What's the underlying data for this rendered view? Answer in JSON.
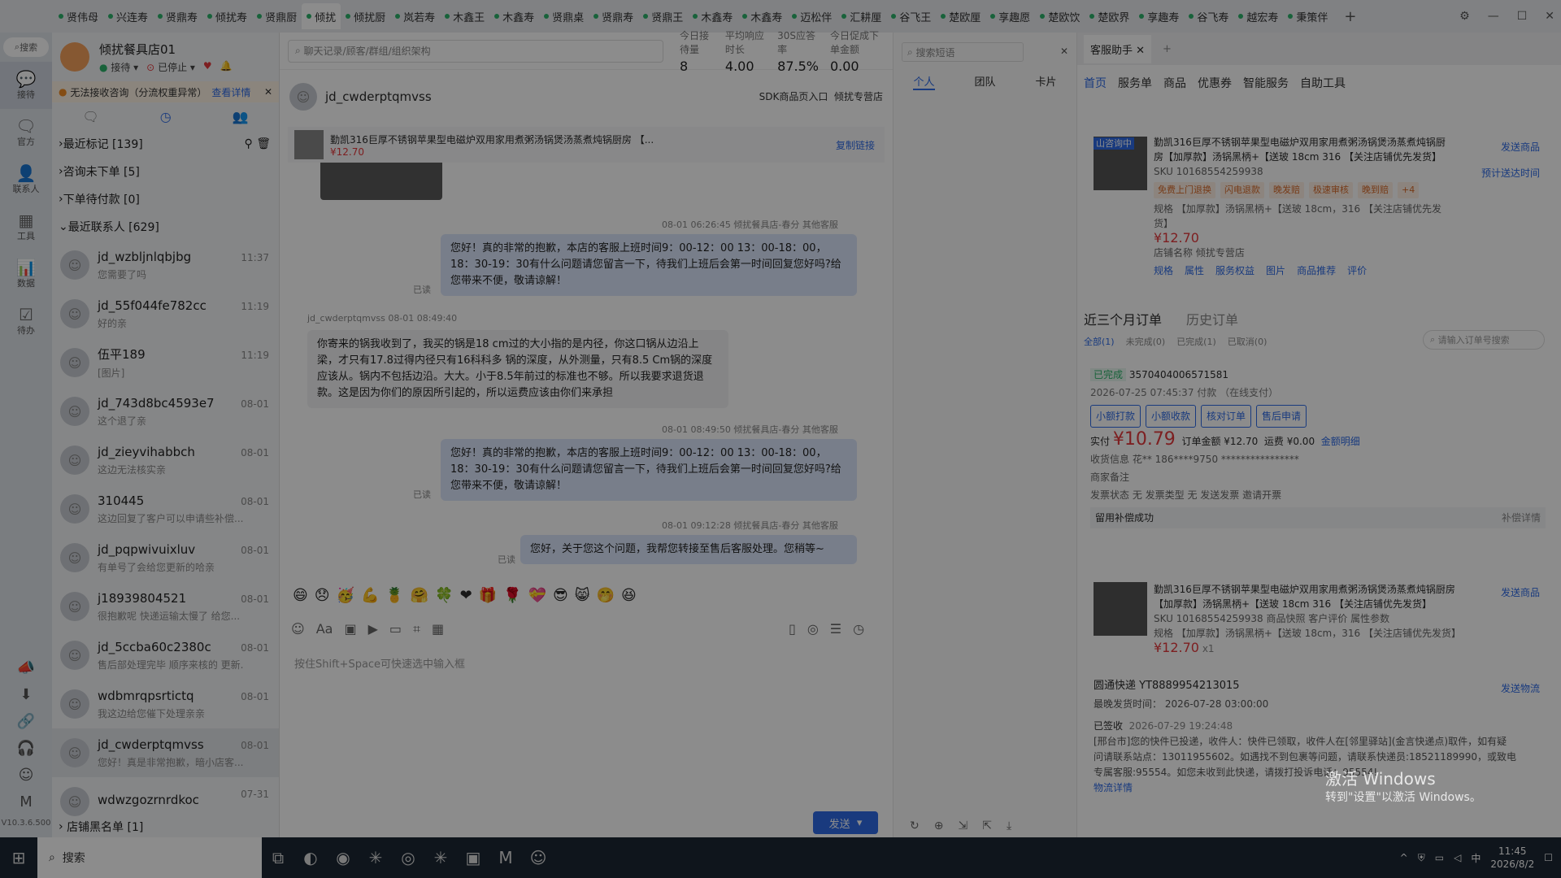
{
  "top_tabs": [
    "贤伟母",
    "兴连寿",
    "贤鼎寿",
    "倾扰寿",
    "贤鼎厨",
    "倾扰",
    "倾扰厨",
    "岚若寿",
    "木鑫王",
    "木鑫寿",
    "贤鼎桌",
    "贤鼎寿",
    "贤鼎王",
    "木鑫寿",
    "木鑫寿",
    "迈松伴",
    "汇耕厘",
    "谷飞王",
    "楚欧厘",
    "享趣愿",
    "楚欧饮",
    "楚欧界",
    "享趣寿",
    "谷飞寿",
    "越宏寿",
    "秉策伴"
  ],
  "rail": {
    "search": "搜索",
    "items": [
      {
        "icon": "💬",
        "label": "接待"
      },
      {
        "icon": "🗨",
        "label": "官方"
      },
      {
        "icon": "👤",
        "label": "联系人"
      },
      {
        "icon": "▦",
        "label": "工具"
      },
      {
        "icon": "📊",
        "label": "数据"
      },
      {
        "icon": "☑",
        "label": "待办"
      }
    ],
    "version": "V10.3.6.500",
    "bottom_icons": [
      "📣",
      "⬇",
      "🔗",
      "🎧",
      "☺",
      "M"
    ]
  },
  "shop": {
    "name": "倾扰餐具店01",
    "status": "接待",
    "stopped": "已停止"
  },
  "warning": {
    "text": "无法接收咨询（分流权重异常）",
    "link": "查看详情"
  },
  "groups": [
    "最近标记 [139]",
    "咨询未下单 [5]",
    "下单待付款 [0]",
    "最近联系人 [629]"
  ],
  "contacts": [
    {
      "name": "jd_wzbljnlqbjbg",
      "msg": "您需要了吗",
      "time": "11:37"
    },
    {
      "name": "jd_55f044fe782cc",
      "msg": "好的亲",
      "time": "11:19"
    },
    {
      "name": "伍平189",
      "msg": "[图片]",
      "time": "11:19"
    },
    {
      "name": "jd_743d8bc4593e7",
      "msg": "这个退了亲",
      "time": "08-01"
    },
    {
      "name": "jd_zieyvihabbch",
      "msg": "这边无法核实亲",
      "time": "08-01"
    },
    {
      "name": "310445",
      "msg": "这边回复了客户可以申请些补偿...",
      "time": "08-01"
    },
    {
      "name": "jd_pqpwivuixluv",
      "msg": "有单号了会给您更新的哈亲",
      "time": "08-01"
    },
    {
      "name": "j18939804521",
      "msg": "很抱歉呢 快递运输太慢了 给您...",
      "time": "08-01"
    },
    {
      "name": "jd_5ccba60c2380c",
      "msg": "售后部处理完毕 顺序来核的 更新...",
      "time": "08-01"
    },
    {
      "name": "wdbmrqpsrtictq",
      "msg": "我这边给您催下处理亲亲",
      "time": "08-01"
    },
    {
      "name": "jd_cwderptqmvss",
      "msg": "您好！真是非常抱歉，暗小店客...",
      "time": "08-01"
    },
    {
      "name": "wdwzgozrnrdkoc",
      "msg": "",
      "time": "07-31"
    }
  ],
  "blacklist": "店铺黑名单 [1]",
  "chat": {
    "search_placeholder": "聊天记录/顾客/群组/组织架构",
    "stats": [
      {
        "k": "今日接待量",
        "v": "8"
      },
      {
        "k": "平均响应时长",
        "v": "4.00"
      },
      {
        "k": "30S应答率",
        "v": "87.5%"
      },
      {
        "k": "今日促成下单金额",
        "v": "0.00"
      }
    ],
    "customer": "jd_cwderptqmvss",
    "sdk": "SDK商品页入口",
    "shop_tag": "倾扰专营店",
    "product_title": "勤凯316巨厚不锈钢苹果型电磁炉双用家用煮粥汤锅煲汤蒸煮炖锅厨房 【...",
    "product_price": "¥12.70",
    "copy_link": "复制链接",
    "messages": [
      {
        "meta": "08-01 06:26:45  倾扰餐具店-春分  其他客服",
        "text": "您好！真的非常的抱歉，本店的客服上班时间9：00-12：00  13：00-18：00，18：30-19：30有什么问题请您留言一下，待我们上班后会第一时间回复您好吗?给您带来不便，敬请谅解！",
        "read": "已读"
      },
      {
        "meta": "jd_cwderptqmvss  08-01 08:49:40",
        "text": "你寄来的锅我收到了，我买的锅是18 cm过的大小指的是内径，你这口锅从边沿上梁，才只有17.8过得内径只有16科科多 锅的深度，从外测量，只有8.5 Cm锅的深度应该从。锅内不包括边沿。大大。小于8.5年前过的标准也不够。所以我要求退货退款。这是因为你们的原因所引起的，所以运费应该由你们来承担"
      },
      {
        "meta": "08-01 08:49:50  倾扰餐具店-春分  其他客服",
        "text": "您好！真的非常的抱歉，本店的客服上班时间9：00-12：00  13：00-18：00，18：30-19：30有什么问题请您留言一下，待我们上班后会第一时间回复您好吗?给您带来不便，敬请谅解！",
        "read": "已读"
      },
      {
        "meta": "08-01 09:12:28  倾扰餐具店-春分  其他客服",
        "text": "您好，关于您这个问题，我帮您转接至售后客服处理。您稍等~",
        "read": "已读"
      }
    ],
    "input_placeholder": "按住Shift+Space可快速选中输入框",
    "send": "发送"
  },
  "quick": {
    "search": "搜索短语",
    "tabs": [
      "个人",
      "团队",
      "卡片"
    ]
  },
  "assist": {
    "title": "客服助手",
    "tabs": [
      "首页",
      "服务单",
      "商品",
      "优惠券",
      "智能服务",
      "自助工具"
    ],
    "product": {
      "badge": "山咨询中",
      "title": "勤凯316巨厚不锈钢苹果型电磁炉双用家用煮粥汤锅煲汤蒸煮炖锅厨房【加厚款】汤锅黑柄+【送玻 18cm 316 【关注店铺优先发货】",
      "sku": "SKU 10168554259938",
      "tags": [
        "免费上门退换",
        "闪电退款",
        "晚发赔",
        "极速审核",
        "晚到赔",
        "+4"
      ],
      "spec": "规格 【加厚款】汤锅黑柄+【送玻 18cm，316 【关注店铺优先发货】",
      "price": "¥12.70",
      "shop": "店铺名称 倾扰专营店",
      "links": [
        "规格",
        "属性",
        "服务权益",
        "图片",
        "商品推荐",
        "评价"
      ],
      "send": "发送商品",
      "eta": "预计送达时间"
    },
    "orders_title": "近三个月订单",
    "history": "历史订单",
    "filters": [
      "全部(1)",
      "未完成(0)",
      "已完成(1)",
      "已取消(0)"
    ],
    "order_search": "请输入订单号搜索",
    "order": {
      "status": "已完成",
      "id": "3570404006571581",
      "time": "2026-07-25 07:45:37 付款 （在线支付）",
      "btns": [
        "小额打款",
        "小额收款",
        "核对订单",
        "售后申请"
      ],
      "paid": "¥10.79",
      "amount": "订单金额 ¥12.70",
      "freight": "运费 ¥0.00",
      "detail": "金额明细",
      "receiver": "收货信息  花**    186****9750   ****************",
      "note": "商家备注",
      "invoice": "发票状态  无   发票类型  无   发送发票   邀请开票",
      "retain": "留用补偿成功",
      "retain_r": "补偿详情",
      "item_title": "勤凯316巨厚不锈钢苹果型电磁炉双用家用煮粥汤锅煲汤蒸煮炖锅厨房【加厚款】汤锅黑柄+【送玻 18cm 316 【关注店铺优先发货】",
      "item_sku": "SKU 10168554259938  商品快照  客户评价  属性参数",
      "item_spec": "规格 【加厚款】汤锅黑柄+【送玻 18cm，316 【关注店铺优先发货】",
      "item_price": "¥12.70",
      "qty": "x1",
      "express": "圆通快递 YT8889954213015",
      "ship_latest": "最晚发货时间：  2026-07-28 03:00:00",
      "signed": "已签收",
      "signed_time": "2026-07-29 19:24:48",
      "track": "[邢台市]您的快件已投递，收件人：快件已领取，收件人在[邻里驿站](金言快递点)取件，如有疑问请联系站点：13011955602。如遇找不到包裹等问题，请联系快递员:18521189990，或致电专属客服:95554。如您未收到此快递，请拨打投诉电话：95554!",
      "logistics": "物流详情",
      "send_logi": "发送物流"
    }
  },
  "watermark": {
    "l1": "激活 Windows",
    "l2": "转到\"设置\"以激活 Windows。"
  },
  "taskbar": {
    "search": "搜索",
    "time": "11:45",
    "date": "2026/8/2"
  }
}
